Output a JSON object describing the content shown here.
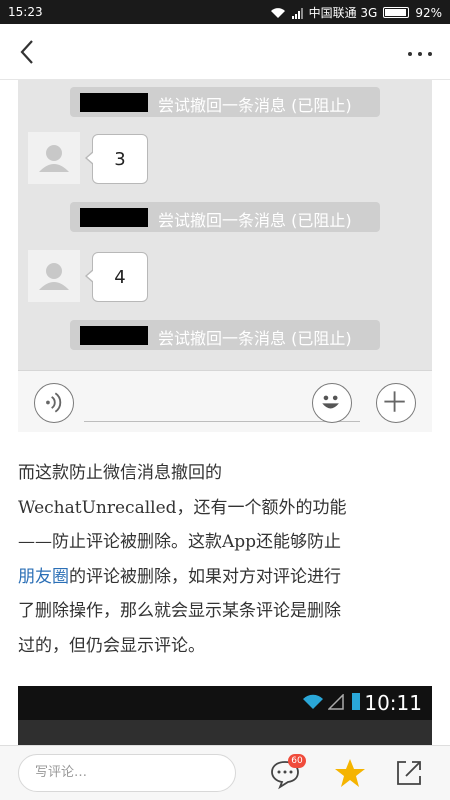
{
  "status_bar": {
    "time": "15:23",
    "carrier": "中国联通 3G",
    "battery": "92%",
    "battery_level": 0.92
  },
  "header": {
    "back_icon": "chevron-left-icon",
    "more_icon": "more-horizontal-icon"
  },
  "chat": {
    "system_message": "尝试撤回一条消息 (已阻止)",
    "bubbles": [
      "3",
      "4"
    ]
  },
  "article": {
    "p1_a": "而这款防止微信消息撤回的",
    "p1_b": "WechatUnrecalled，还有一个额外的功能",
    "p1_c": "——防止评论被删除。这款App还能够防止",
    "p1_link": "朋友圈",
    "p1_d": "的评论被删除，如果对方对评论进行",
    "p1_e": "了删除操作，那么就会显示某条评论是删除",
    "p1_f": "过的，但仍会显示评论。"
  },
  "screenshot2": {
    "time": "10:11"
  },
  "bottom_bar": {
    "comment_placeholder": "写评论…",
    "comment_count": "60",
    "icons": [
      "comment-icon",
      "star-icon",
      "share-icon"
    ],
    "star_color": "#f5b400"
  }
}
